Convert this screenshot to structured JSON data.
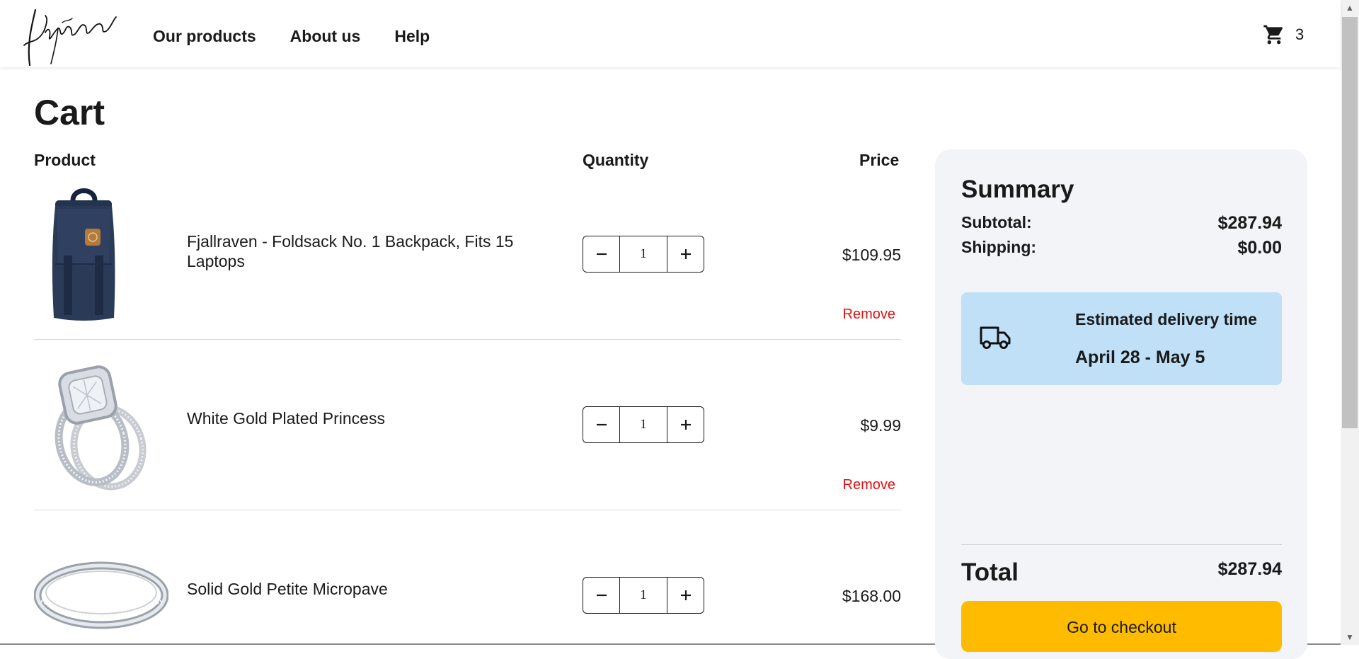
{
  "header": {
    "brand": "Lipsum",
    "nav": [
      "Our products",
      "About us",
      "Help"
    ],
    "cart_count": "3",
    "icons": {
      "cart": "shopping-cart-icon"
    }
  },
  "cart": {
    "title": "Cart",
    "columns": {
      "product": "Product",
      "quantity": "Quantity",
      "price": "Price"
    },
    "items": [
      {
        "name": "Fjallraven - Foldsack No. 1 Backpack, Fits 15 Laptops",
        "quantity": "1",
        "price": "$109.95",
        "remove": "Remove",
        "image": "backpack-image"
      },
      {
        "name": "White Gold Plated Princess",
        "quantity": "1",
        "price": "$9.99",
        "remove": "Remove",
        "image": "princess-ring-image"
      },
      {
        "name": "Solid Gold Petite Micropave",
        "quantity": "1",
        "price": "$168.00",
        "image": "micropave-band-image"
      }
    ]
  },
  "summary": {
    "title": "Summary",
    "subtotal_label": "Subtotal:",
    "subtotal": "$287.94",
    "shipping_label": "Shipping:",
    "shipping": "$0.00",
    "delivery_label": "Estimated delivery time",
    "delivery_range": "April 28 - May 5",
    "total_label": "Total",
    "total": "$287.94",
    "checkout_label": "Go to checkout"
  },
  "colors": {
    "checkout": "#ffbb00",
    "delivery_bg": "#bfe0f7",
    "summary_bg": "#f3f4f8",
    "remove": "#e01010"
  }
}
